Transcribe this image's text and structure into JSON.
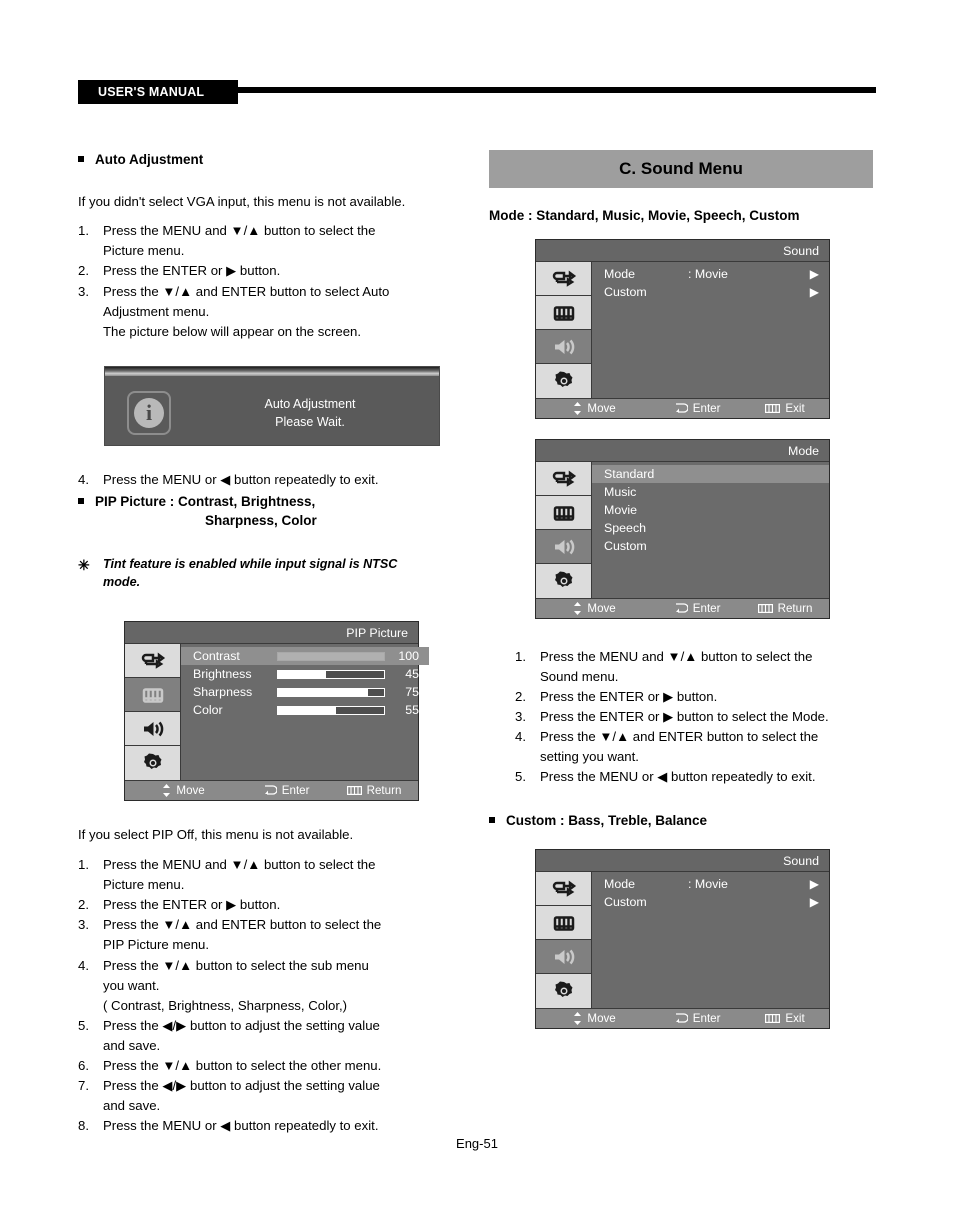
{
  "header": {
    "tag": "USER'S MANUAL"
  },
  "footer": {
    "page": "Eng-51"
  },
  "left": {
    "auto_adjustment": {
      "heading": "Auto Adjustment",
      "intro": "If you didn't select VGA input, this menu is not available.",
      "steps": [
        {
          "num": "1.",
          "text": "Press the MENU and ▼/▲ button to select the"
        },
        {
          "num": "2.",
          "text": "Press the ENTER or ▶ button."
        },
        {
          "num": "3.",
          "text": "Press the ▼/▲ and ENTER button to select Auto"
        }
      ],
      "step1_cont": "Picture menu.",
      "step3_cont": "Adjustment menu.",
      "step3_cont2": "The picture below will appear on the screen.",
      "dialog": {
        "icon": "info-icon",
        "line1": "Auto Adjustment",
        "line2": "Please Wait."
      },
      "step4": {
        "num": "4.",
        "text": "Press the MENU or ◀ button repeatedly to exit."
      }
    },
    "pip_picture": {
      "heading_line1": "PIP Picture : Contrast, Brightness,",
      "heading_line2": "Sharpness, Color",
      "note_star": "✳",
      "note_line1": "Tint feature is enabled while input signal is NTSC",
      "note_line2": "mode.",
      "osd": {
        "title": "PIP Picture",
        "icons": [
          "source-icon",
          "picture-icon",
          "sound-icon",
          "setup-icon"
        ],
        "active_icon_index": 1,
        "rows": [
          {
            "label": "Contrast",
            "value": "100",
            "fill": 100,
            "highlight": true
          },
          {
            "label": "Brightness",
            "value": "45",
            "fill": 45,
            "highlight": false
          },
          {
            "label": "Sharpness",
            "value": "75",
            "fill": 75,
            "highlight": false
          },
          {
            "label": "Color",
            "value": "55",
            "fill": 55,
            "highlight": false
          }
        ],
        "foot": {
          "move": "Move",
          "enter": "Enter",
          "exit": "Return"
        }
      },
      "intro": " If you select PIP Off, this menu is not available.",
      "steps": [
        {
          "num": "1.",
          "text": "Press the MENU and ▼/▲ button to select the"
        },
        {
          "num": "2.",
          "text": "Press  the ENTER or ▶ button."
        },
        {
          "num": "3.",
          "text": "Press  the ▼/▲ and ENTER button to select the"
        },
        {
          "num": "4.",
          "text": "Press the ▼/▲ button to select the sub menu"
        },
        {
          "num": "5.",
          "text": "Press the ◀/▶ button to adjust the setting value"
        },
        {
          "num": "6.",
          "text": "Press the ▼/▲ button to select the other menu."
        },
        {
          "num": "7.",
          "text": "Press the ◀/▶ button to adjust the setting value"
        },
        {
          "num": "8.",
          "text": "Press the MENU or ◀ button repeatedly to exit."
        }
      ],
      "step1_cont": "Picture menu.",
      "step3_cont": "PIP Picture menu.",
      "step4_cont": "you want.",
      "step4_cont2": "( Contrast, Brightness, Sharpness, Color,)",
      "step5_cont": "and save.",
      "step7_cont": "and save."
    }
  },
  "right": {
    "banner": "C. Sound Menu",
    "mode_line": "Mode : Standard, Music, Movie, Speech, Custom",
    "osd_sound_top": {
      "title": "Sound",
      "icons": [
        "source-icon",
        "picture-icon",
        "sound-icon",
        "setup-icon"
      ],
      "active_icon_index": 2,
      "rows": [
        {
          "label": "Mode",
          "value": ": Movie",
          "arrow": "▶"
        },
        {
          "label": "Custom",
          "value": "",
          "arrow": "▶"
        }
      ],
      "foot": {
        "move": "Move",
        "enter": "Enter",
        "exit": "Exit"
      }
    },
    "osd_mode": {
      "title": "Mode",
      "icons": [
        "source-icon",
        "picture-icon",
        "sound-icon",
        "setup-icon"
      ],
      "active_icon_index": 2,
      "items": [
        {
          "label": "Standard",
          "highlight": true
        },
        {
          "label": "Music",
          "highlight": false
        },
        {
          "label": "Movie",
          "highlight": false
        },
        {
          "label": "Speech",
          "highlight": false
        },
        {
          "label": "Custom",
          "highlight": false
        }
      ],
      "foot": {
        "move": "Move",
        "enter": "Enter",
        "exit": "Return"
      }
    },
    "steps": [
      {
        "num": "1.",
        "text": "Press the MENU and ▼/▲ button to select the"
      },
      {
        "num": "2.",
        "text": "Press the ENTER or ▶ button."
      },
      {
        "num": "3.",
        "text": "Press the ENTER or ▶ button to select the Mode."
      },
      {
        "num": "4.",
        "text": "Press the ▼/▲ and ENTER button to select the"
      },
      {
        "num": "5.",
        "text": "Press the MENU or ◀ button repeatedly to exit."
      }
    ],
    "step1_cont": "Sound menu.",
    "step4_cont": "setting you want.",
    "custom_heading": "Custom : Bass, Treble, Balance",
    "osd_sound_bottom": {
      "title": "Sound",
      "icons": [
        "source-icon",
        "picture-icon",
        "sound-icon",
        "setup-icon"
      ],
      "active_icon_index": 2,
      "rows": [
        {
          "label": "Mode",
          "value": ": Movie",
          "arrow": "▶"
        },
        {
          "label": "Custom",
          "value": "",
          "arrow": "▶"
        }
      ],
      "foot": {
        "move": "Move",
        "enter": "Enter",
        "exit": "Exit"
      }
    }
  }
}
